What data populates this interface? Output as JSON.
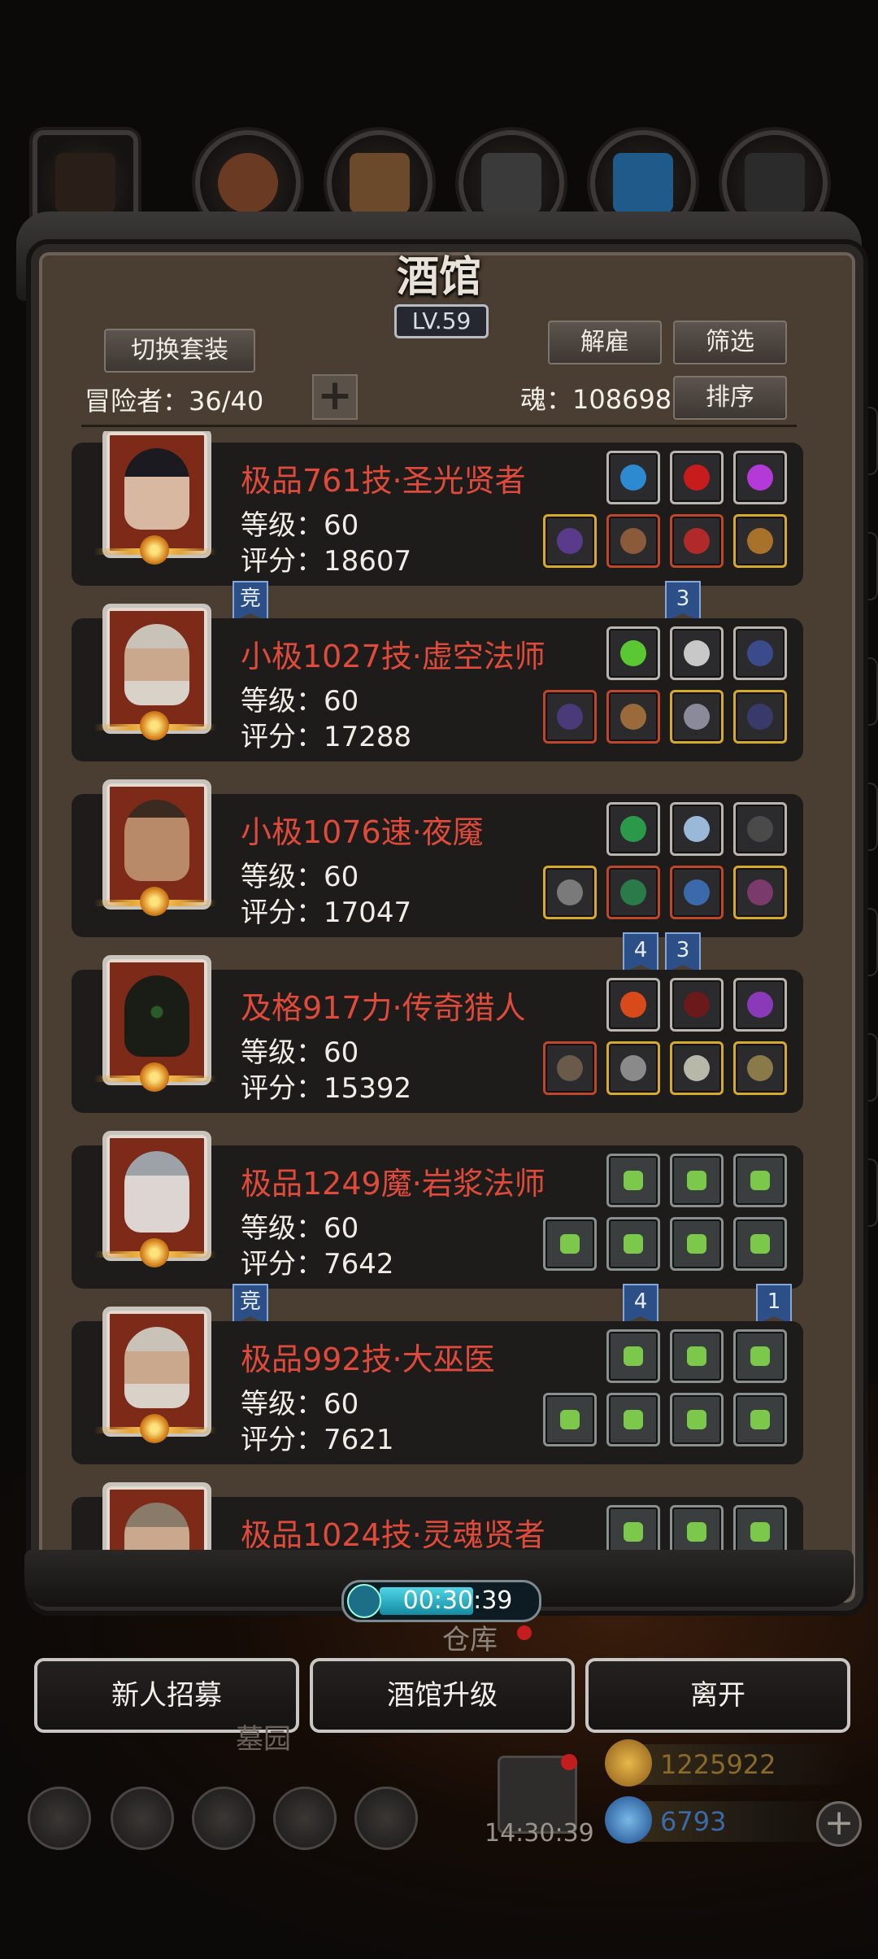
{
  "top_icons": [
    "dragon-icon",
    "helmet-icon",
    "wood-icon",
    "iron-icon",
    "crystal-icon",
    "stone-icon"
  ],
  "panel": {
    "title": "酒馆",
    "level": "LV.59",
    "switch_label": "切换套装",
    "dismiss_label": "解雇",
    "filter_label": "筛选",
    "sort_label": "排序",
    "adventurers": "冒险者：36/40",
    "soul": "魂：108698",
    "add_symbol": "+"
  },
  "heroes": [
    {
      "name": "极品761技·圣光贤者",
      "level": "等级：60",
      "score": "评分：18607",
      "face": "#d8b8a0",
      "hair": "#1b1a20"
    },
    {
      "name": "小极1027技·虚空法师",
      "level": "等级：60",
      "score": "评分：17288",
      "face": "#c9a88e",
      "hair": "#c8c2b8"
    },
    {
      "name": "小极1076速·夜魇",
      "level": "等级：60",
      "score": "评分：17047",
      "face": "#b88a6a",
      "hair": "#3a2a20"
    },
    {
      "name": "及格917力·传奇猎人",
      "level": "等级：60",
      "score": "评分：15392",
      "face": "#1a1d16",
      "hair": "#0d0e0c"
    },
    {
      "name": "极品1249魔·岩浆法师",
      "level": "等级：60",
      "score": "评分：7642",
      "face": "#dcd5d2",
      "hair": "#9da2a8"
    },
    {
      "name": "极品992技·大巫医",
      "level": "等级：60",
      "score": "评分：7621",
      "face": "#c9a88e",
      "hair": "#c8c2b8"
    },
    {
      "name": "极品1024技·灵魂贤者",
      "level": "",
      "score": "",
      "face": "#c9a88e",
      "hair": "#8a7a6a"
    }
  ],
  "tags": {
    "jing": "竞",
    "t1": "3",
    "t2": "4",
    "t3": "3",
    "t4": "4",
    "t5": "1"
  },
  "timer": "00:30:39",
  "warehouse": "仓库",
  "buttons": {
    "recruit": "新人招募",
    "upgrade": "酒馆升级",
    "leave": "离开"
  },
  "garden": "墓园",
  "gift_time": "14:30:39",
  "currency": {
    "gold": "1225922",
    "gold_color": "#8a6a2a",
    "gem": "6793",
    "gem_color": "#3b6aa6"
  },
  "colors": {
    "name_red": "#e04a3a",
    "panel": "#4a3d31",
    "timer_fill": "#4fd6e6"
  }
}
